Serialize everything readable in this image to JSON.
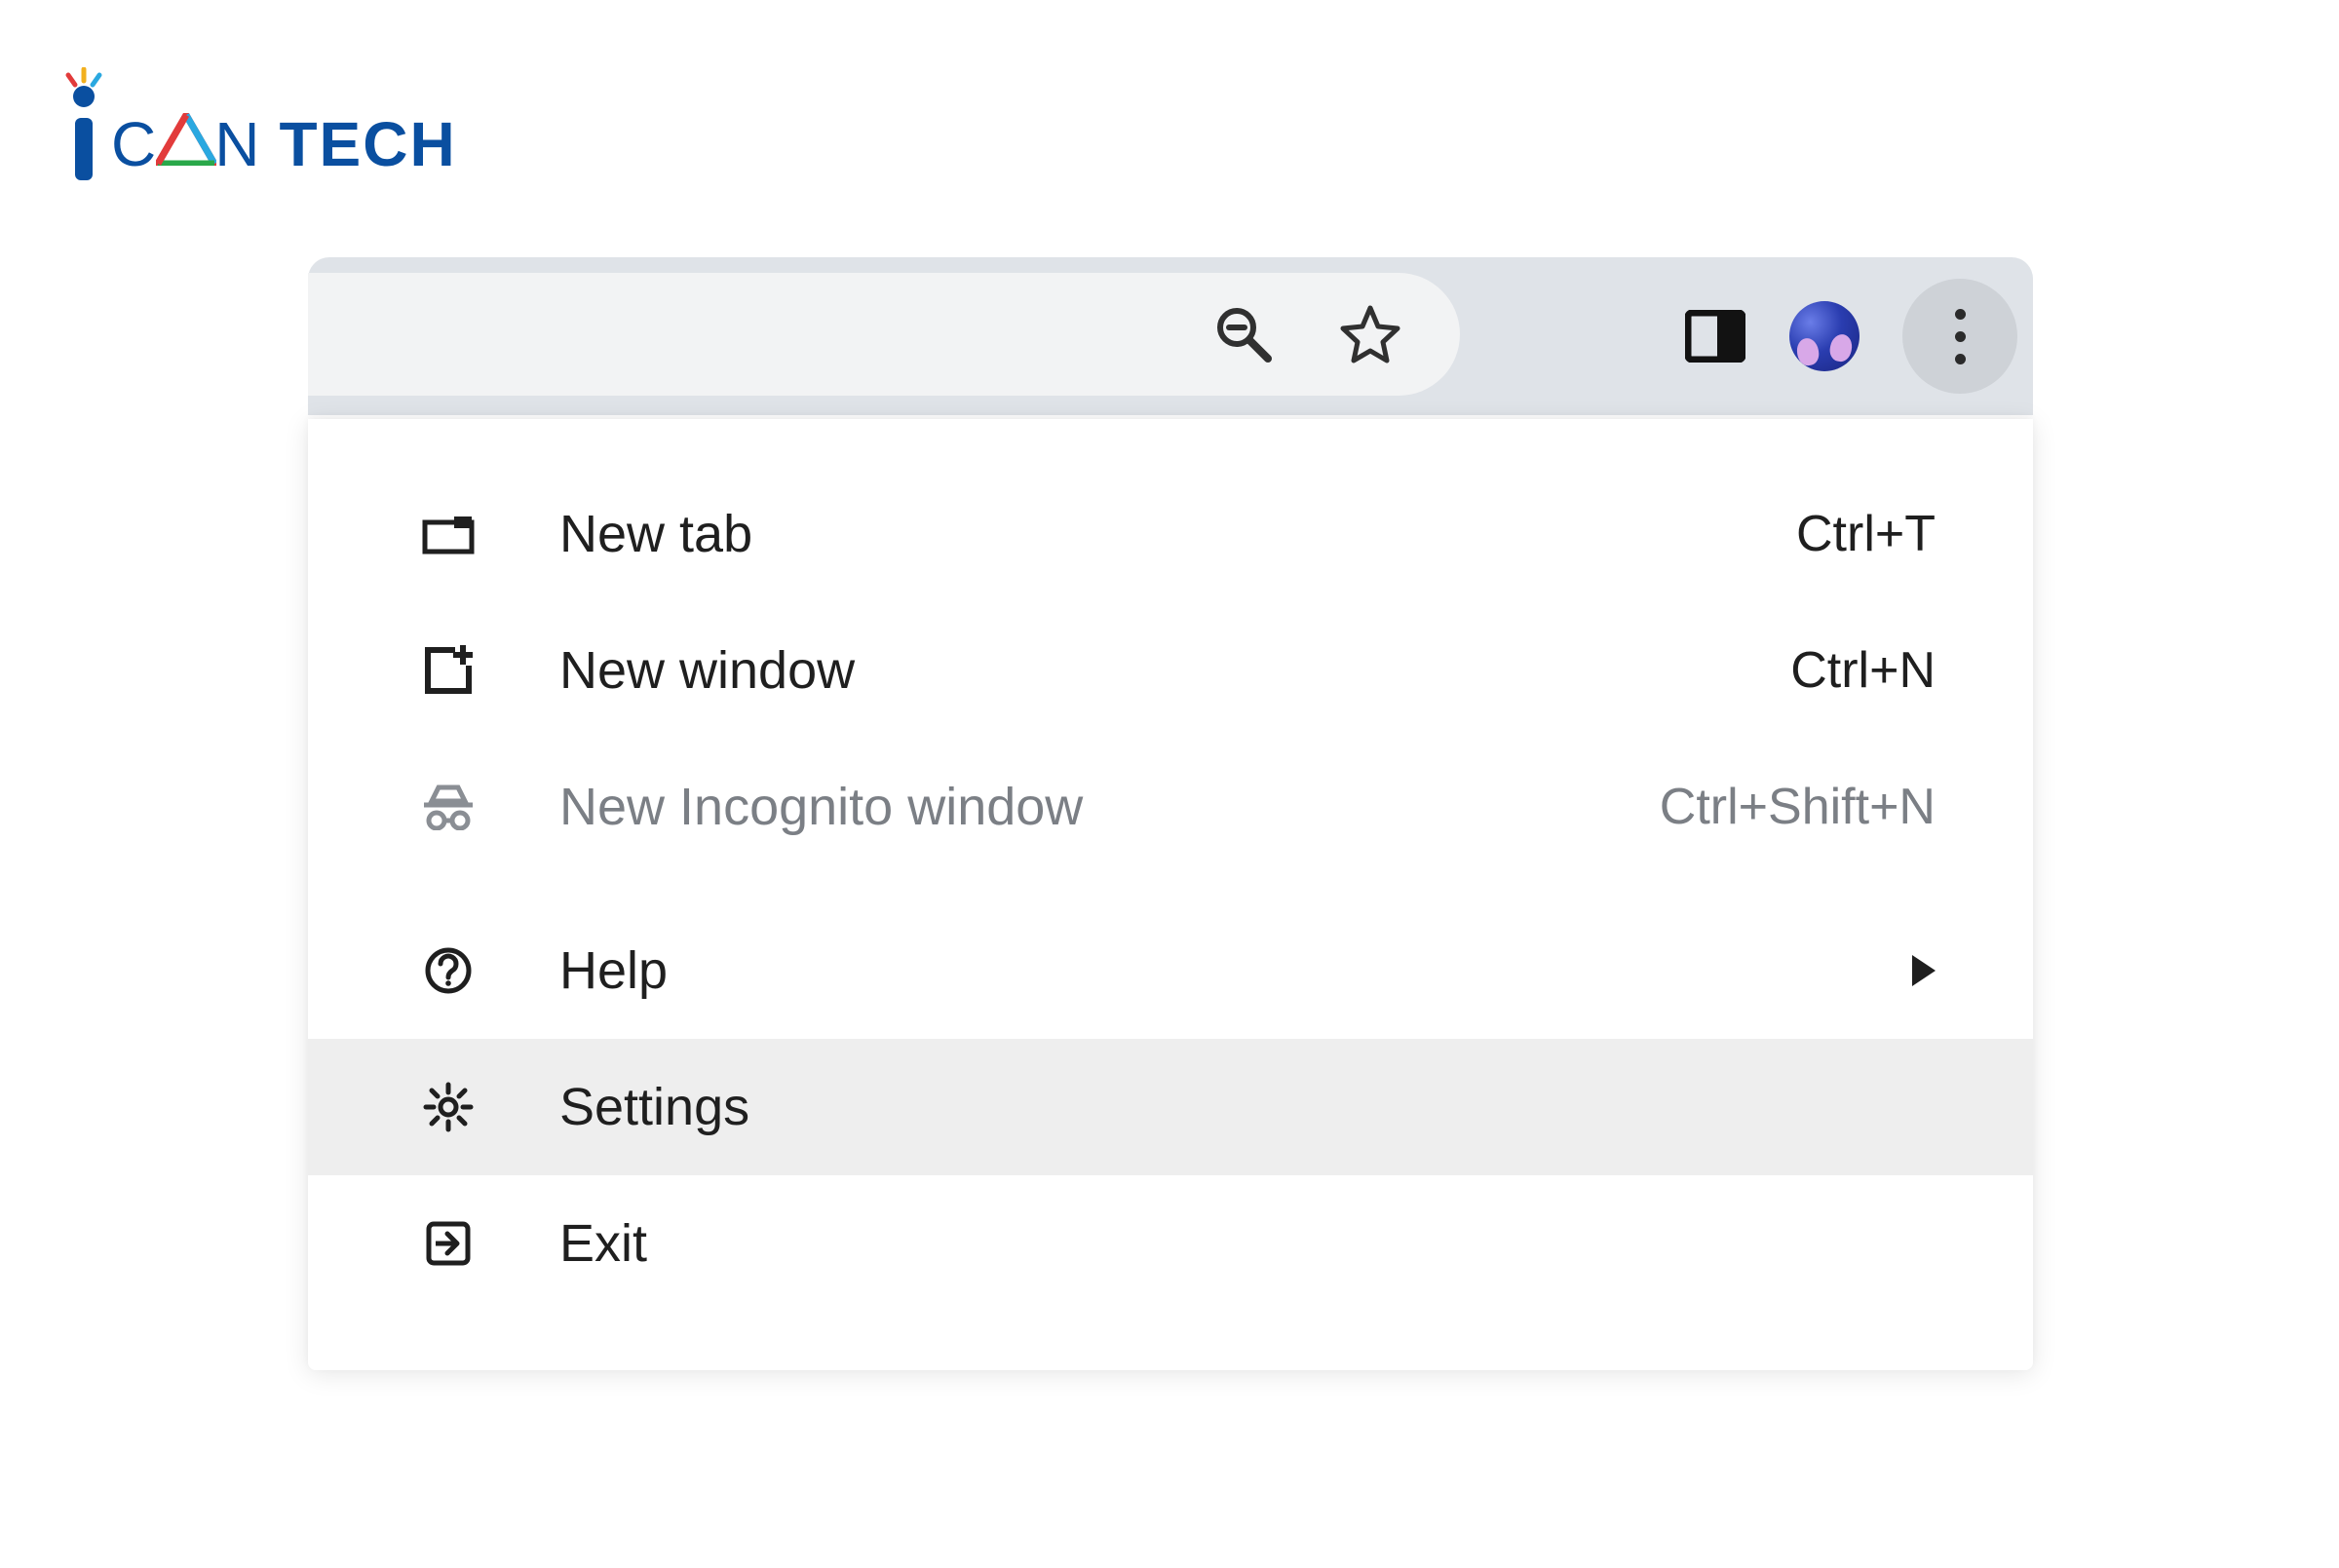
{
  "logo": {
    "brand_prefix": "CAN",
    "brand_suffix": "TECH"
  },
  "toolbar": {
    "icons": {
      "zoom": "zoom-out-icon",
      "star": "star-icon",
      "panel": "side-panel-icon",
      "avatar": "profile-avatar",
      "more": "more-menu-icon"
    }
  },
  "menu": {
    "items": [
      {
        "icon": "tab-icon",
        "label": "New tab",
        "accel": "Ctrl+T",
        "type": "normal"
      },
      {
        "icon": "window-icon",
        "label": "New window",
        "accel": "Ctrl+N",
        "type": "normal"
      },
      {
        "icon": "incognito-icon",
        "label": "New Incognito window",
        "accel": "Ctrl+Shift+N",
        "type": "disabled"
      },
      {
        "icon": "help-icon",
        "label": "Help",
        "accel": "",
        "type": "submenu"
      },
      {
        "icon": "settings-icon",
        "label": "Settings",
        "accel": "",
        "type": "hover"
      },
      {
        "icon": "exit-icon",
        "label": "Exit",
        "accel": "",
        "type": "normal"
      }
    ]
  }
}
